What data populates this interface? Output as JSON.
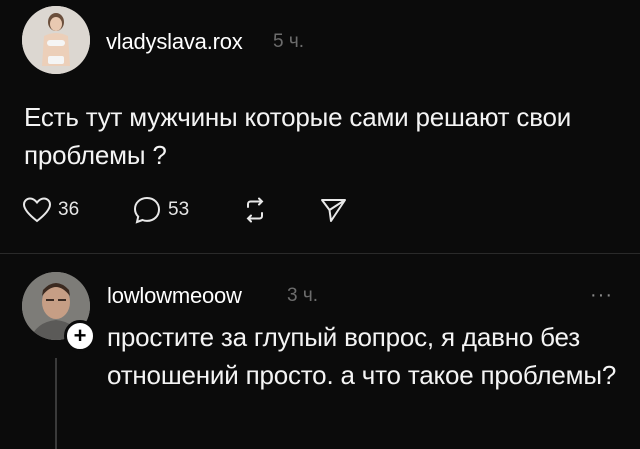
{
  "post": {
    "username": "vladyslava.rox",
    "time": "5 ч.",
    "text": "Есть тут мужчины которые сами решают свои проблемы ?",
    "likes": "36",
    "comments": "53",
    "avatar_icon": "woman-photo-avatar",
    "like_icon": "heart-icon",
    "comment_icon": "speech-bubble-icon",
    "repost_icon": "repost-icon",
    "share_icon": "paper-plane-icon"
  },
  "reply": {
    "username": "lowlowmeoow",
    "time": "3 ч.",
    "text": "простите за глупый вопрос, я давно без отношений просто. а что такое проблемы?",
    "more_label": "···",
    "follow_label": "+",
    "avatar_icon": "man-photo-avatar"
  }
}
